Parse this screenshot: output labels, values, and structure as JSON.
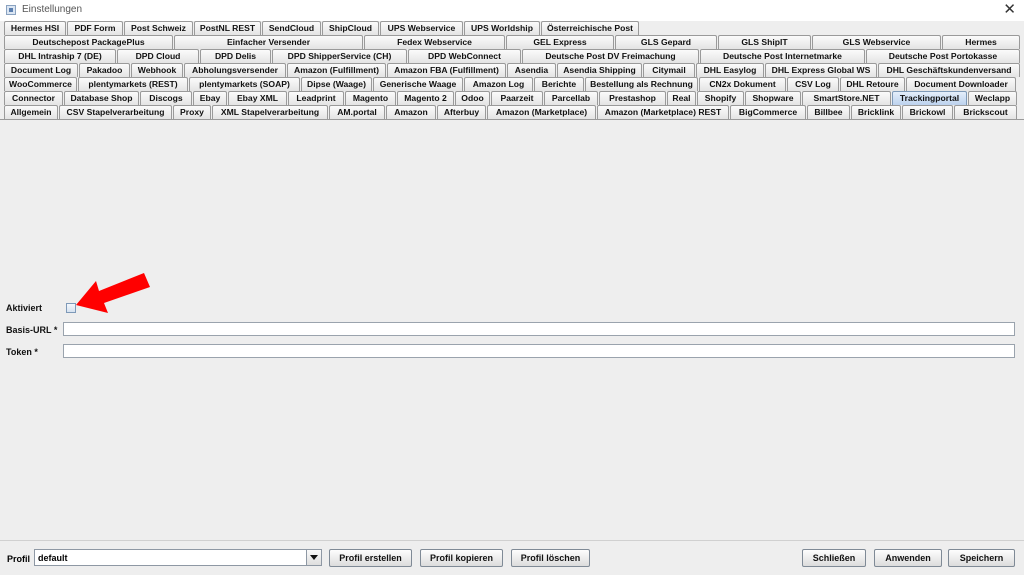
{
  "window": {
    "title": "Einstellungen",
    "close_symbol": "✕"
  },
  "tab_rows": [
    [
      "Hermes HSI",
      "PDF Form",
      "Post Schweiz",
      "PostNL REST",
      "SendCloud",
      "ShipCloud",
      "UPS Webservice",
      "UPS Worldship",
      "Österreichische Post"
    ],
    [
      "Deutschepost PackagePlus",
      "Einfacher Versender",
      "Fedex Webservice",
      "GEL Express",
      "GLS Gepard",
      "GLS ShipIT",
      "GLS Webservice",
      "Hermes"
    ],
    [
      "DHL Intraship 7 (DE)",
      "DPD Cloud",
      "DPD Delis",
      "DPD ShipperService (CH)",
      "DPD WebConnect",
      "Deutsche Post DV Freimachung",
      "Deutsche Post Internetmarke",
      "Deutsche Post Portokasse"
    ],
    [
      "Document Log",
      "Pakadoo",
      "Webhook",
      "Abholungsversender",
      "Amazon (Fulfillment)",
      "Amazon FBA (Fulfillment)",
      "Asendia",
      "Asendia Shipping",
      "Citymail",
      "DHL Easylog",
      "DHL Express Global WS",
      "DHL Geschäftskundenversand"
    ],
    [
      "WooCommerce",
      "plentymarkets (REST)",
      "plentymarkets (SOAP)",
      "Dipse (Waage)",
      "Generische Waage",
      "Amazon Log",
      "Berichte",
      "Bestellung als Rechnung",
      "CN2x Dokument",
      "CSV Log",
      "DHL Retoure",
      "Document Downloader"
    ],
    [
      "Connector",
      "Database Shop",
      "Discogs",
      "Ebay",
      "Ebay XML",
      "Leadprint",
      "Magento",
      "Magento 2",
      "Odoo",
      "Paarzeit",
      "Parcellab",
      "Prestashop",
      "Real",
      "Shopify",
      "Shopware",
      "SmartStore.NET",
      "Trackingportal",
      "Weclapp"
    ],
    [
      "Allgemein",
      "CSV Stapelverarbeitung",
      "Proxy",
      "XML Stapelverarbeitung",
      "AM.portal",
      "Amazon",
      "Afterbuy",
      "Amazon (Marketplace)",
      "Amazon (Marketplace) REST",
      "BigCommerce",
      "Billbee",
      "Bricklink",
      "Brickowl",
      "Brickscout"
    ]
  ],
  "selected_tab": "Trackingportal",
  "form": {
    "aktiviert_label": "Aktiviert",
    "aktiviert_checked": false,
    "basis_url_label": "Basis-URL *",
    "basis_url_value": "",
    "token_label": "Token *",
    "token_value": ""
  },
  "annotation": {
    "arrow_color": "#ff0000"
  },
  "bottom": {
    "profile_label": "Profil",
    "profile_value": "default",
    "buttons": {
      "create": "Profil erstellen",
      "copy": "Profil kopieren",
      "delete": "Profil löschen",
      "close": "Schließen",
      "apply": "Anwenden",
      "save": "Speichern"
    }
  },
  "colors": {
    "selected_tab": "#bcd2ee",
    "panel_bg": "#eeeeee"
  }
}
